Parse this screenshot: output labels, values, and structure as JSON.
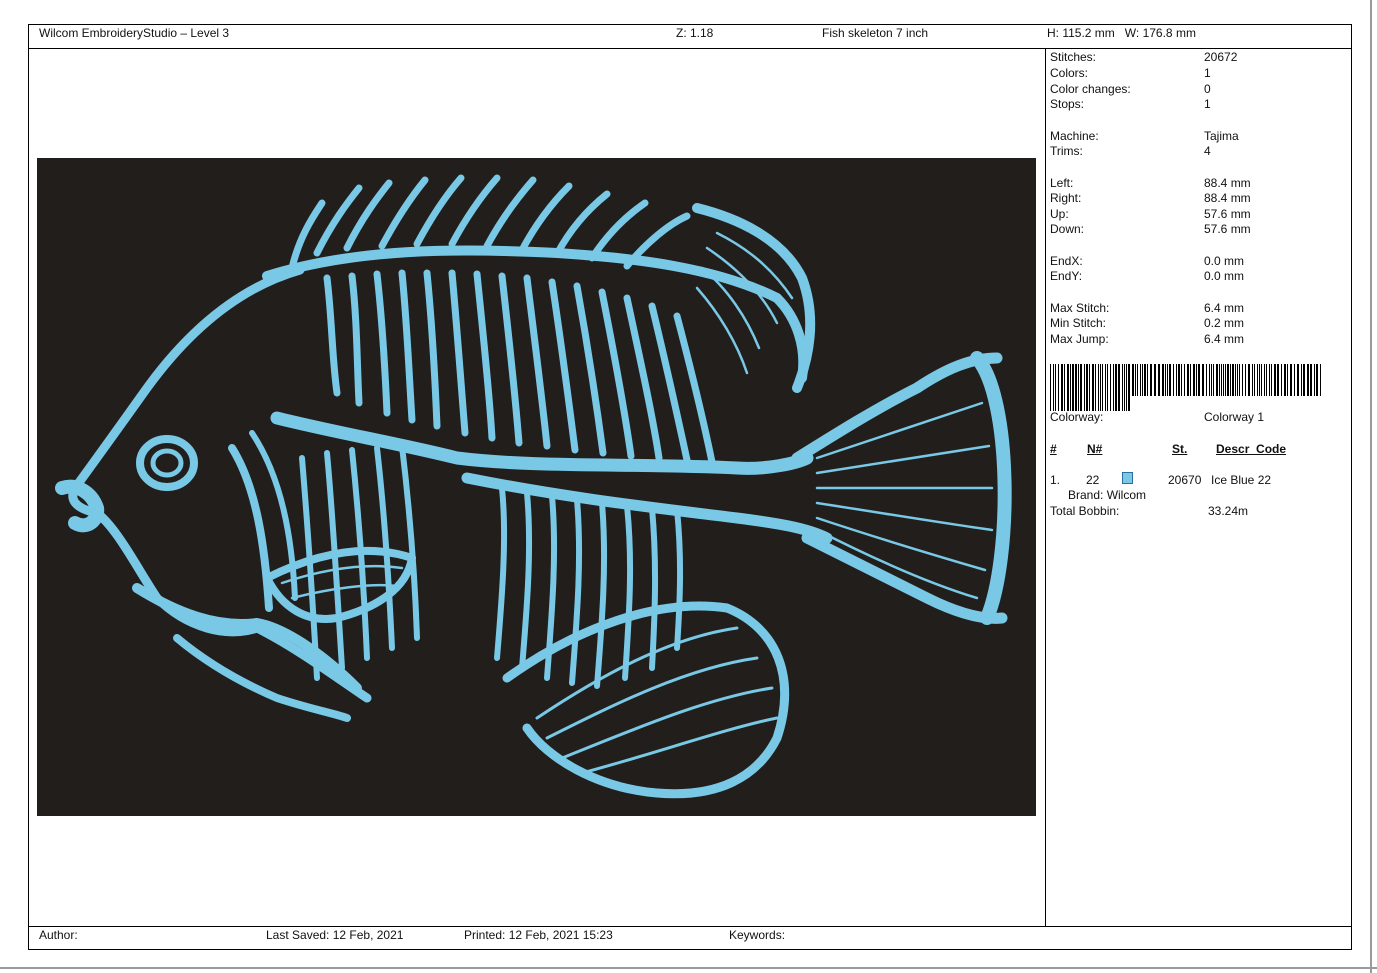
{
  "header": {
    "app_title": "Wilcom EmbroideryStudio – Level 3",
    "zoom": "Z: 1.18",
    "design_name": "Fish skeleton 7 inch",
    "dimensions": "H: 115.2 mm   W: 176.8 mm"
  },
  "stats": [
    {
      "label": "Stitches:",
      "value": "20672"
    },
    {
      "label": "Colors:",
      "value": "1"
    },
    {
      "label": "Color changes:",
      "value": "0"
    },
    {
      "label": "Stops:",
      "value": "1"
    },
    {
      "label": "Machine:",
      "value": "Tajima"
    },
    {
      "label": "Trims:",
      "value": "4"
    },
    {
      "label": "Left:",
      "value": "88.4 mm"
    },
    {
      "label": "Right:",
      "value": "88.4 mm"
    },
    {
      "label": "Up:",
      "value": "57.6 mm"
    },
    {
      "label": "Down:",
      "value": "57.6 mm"
    },
    {
      "label": "EndX:",
      "value": "0.0 mm"
    },
    {
      "label": "EndY:",
      "value": "0.0 mm"
    },
    {
      "label": "Max Stitch:",
      "value": "6.4 mm"
    },
    {
      "label": "Min Stitch:",
      "value": "0.2 mm"
    },
    {
      "label": "Max Jump:",
      "value": "6.4 mm"
    }
  ],
  "colorway": {
    "label": "Colorway:",
    "value": "Colorway 1"
  },
  "color_table": {
    "headers": [
      "#",
      "N#",
      "St.",
      "Descr_Code"
    ],
    "rows": [
      {
        "index": "1.",
        "number": "22",
        "stitches": "20670",
        "description": "Ice Blue 22",
        "brand": "Brand: Wilcom",
        "swatch_color": "#78c8e6"
      }
    ]
  },
  "total_bobbin": {
    "label": "Total Bobbin:",
    "value": "33.24m"
  },
  "footer": {
    "author": "Author:",
    "last_saved": "Last Saved: 12 Feb, 2021",
    "printed": "Printed: 12 Feb, 2021 15:23",
    "keywords": "Keywords:"
  },
  "design_preview": {
    "subject": "fish-skeleton-icon",
    "thread_color": "#78c8e6",
    "background_color": "#221e1b"
  }
}
